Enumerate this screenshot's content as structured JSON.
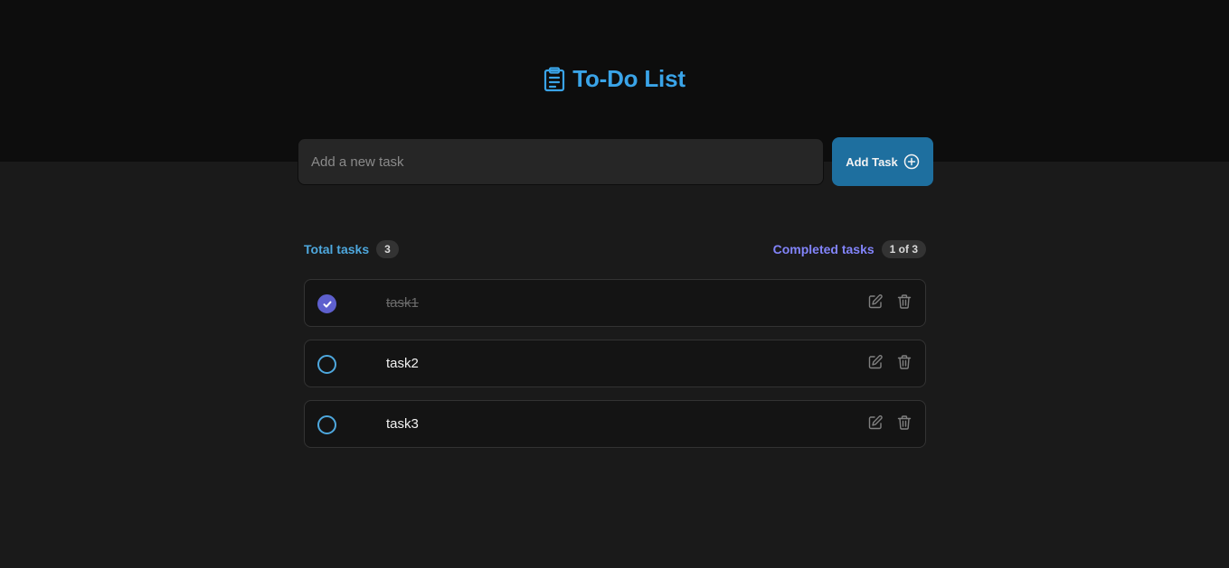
{
  "header": {
    "title": "To-Do List",
    "icon": "clipboard-icon",
    "accent": "#3aa4e8"
  },
  "new_task": {
    "placeholder": "Add a new task",
    "value": "",
    "button_label": "Add Task",
    "button_icon": "plus-circle-icon",
    "button_color": "#1e6f9f"
  },
  "counters": {
    "total_label": "Total tasks",
    "total_count": "3",
    "completed_label": "Completed tasks",
    "completed_count": "1 of 3"
  },
  "tasks": [
    {
      "text": "task1",
      "completed": true,
      "edit_icon": "edit-icon",
      "delete_icon": "trash-icon"
    },
    {
      "text": "task2",
      "completed": false,
      "edit_icon": "edit-icon",
      "delete_icon": "trash-icon"
    },
    {
      "text": "task3",
      "completed": false,
      "edit_icon": "edit-icon",
      "delete_icon": "trash-icon"
    }
  ],
  "colors": {
    "background": "#1a1a1a",
    "header_band": "#0d0d0d",
    "completed_check": "#5e60ce",
    "open_check": "#4ea8de",
    "completed_label": "#8284fa"
  }
}
